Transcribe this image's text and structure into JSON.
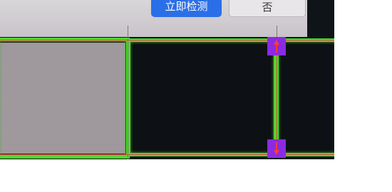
{
  "dialog": {
    "confirm_label": "立即检测",
    "cancel_label": "否"
  },
  "colors": {
    "primary_button": "#2b6fe8",
    "detection_frame": "#52d62e",
    "handle": "#8a2be2",
    "handle_arrow": "#ff3b3b"
  },
  "icons": {
    "top_handle": "resize-handle-up-icon",
    "bottom_handle": "resize-handle-down-icon"
  }
}
